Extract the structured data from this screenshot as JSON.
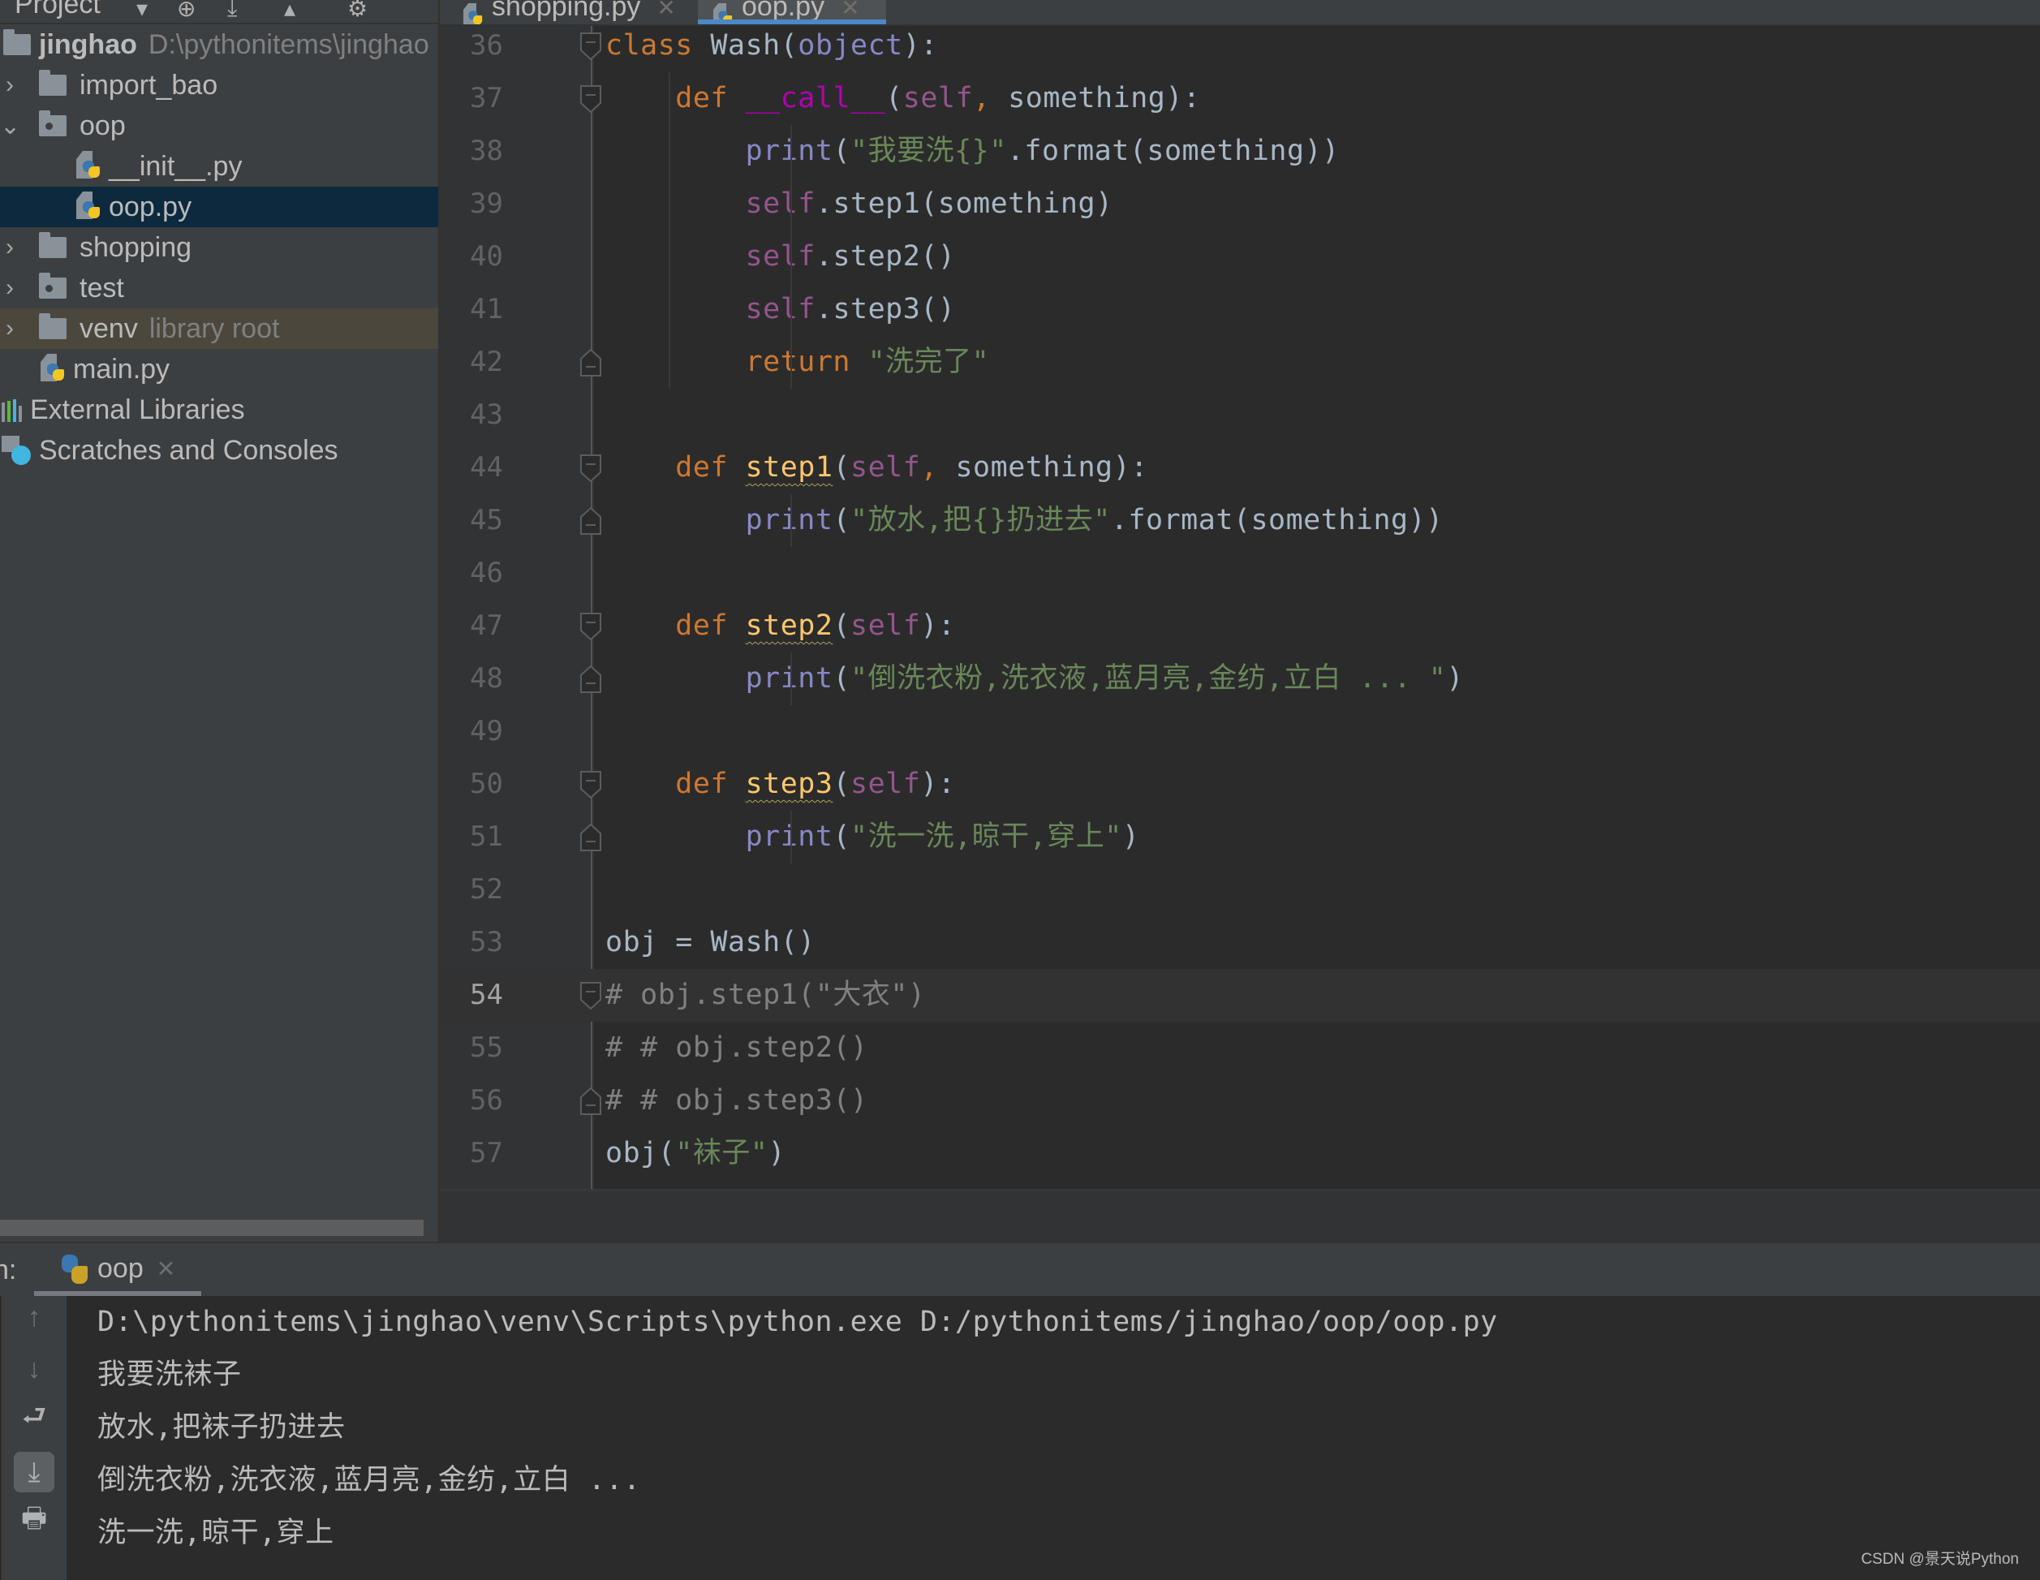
{
  "project_panel": {
    "title": "Project",
    "root": {
      "name": "jinghao",
      "path": "D:\\pythonitems\\jinghao"
    },
    "items": [
      {
        "label": "import_bao",
        "type": "folder",
        "expanded": false,
        "depth": 1
      },
      {
        "label": "oop",
        "type": "package",
        "expanded": true,
        "depth": 1
      },
      {
        "label": "__init__.py",
        "type": "python-file",
        "depth": 2
      },
      {
        "label": "oop.py",
        "type": "python-file",
        "depth": 2,
        "selected": true
      },
      {
        "label": "shopping",
        "type": "folder",
        "expanded": false,
        "depth": 1
      },
      {
        "label": "test",
        "type": "package",
        "expanded": false,
        "depth": 1
      },
      {
        "label": "venv",
        "type": "folder",
        "expanded": false,
        "depth": 1,
        "hint": "library root"
      },
      {
        "label": "main.py",
        "type": "python-file",
        "depth": 1
      },
      {
        "label": "External Libraries",
        "type": "libraries",
        "depth": 0
      },
      {
        "label": "Scratches and Consoles",
        "type": "scratches",
        "depth": 0
      }
    ]
  },
  "editor_tabs": [
    {
      "label": "shopping.py",
      "active": false
    },
    {
      "label": "oop.py",
      "active": true
    }
  ],
  "editor": {
    "current_line": 54,
    "lines": [
      {
        "n": "36",
        "text": "class Wash(object):"
      },
      {
        "n": "37",
        "text": "    def __call__(self, something):"
      },
      {
        "n": "38",
        "text": "        print(\"我要洗{}\".format(something))"
      },
      {
        "n": "39",
        "text": "        self.step1(something)"
      },
      {
        "n": "40",
        "text": "        self.step2()"
      },
      {
        "n": "41",
        "text": "        self.step3()"
      },
      {
        "n": "42",
        "text": "        return \"洗完了\""
      },
      {
        "n": "43",
        "text": ""
      },
      {
        "n": "44",
        "text": "    def step1(self, something):"
      },
      {
        "n": "45",
        "text": "        print(\"放水,把{}扔进去\".format(something))"
      },
      {
        "n": "46",
        "text": ""
      },
      {
        "n": "47",
        "text": "    def step2(self):"
      },
      {
        "n": "48",
        "text": "        print(\"倒洗衣粉,洗衣液,蓝月亮,金纺,立白 ... \")"
      },
      {
        "n": "49",
        "text": ""
      },
      {
        "n": "50",
        "text": "    def step3(self):"
      },
      {
        "n": "51",
        "text": "        print(\"洗一洗,晾干,穿上\")"
      },
      {
        "n": "52",
        "text": ""
      },
      {
        "n": "53",
        "text": "obj = Wash()"
      },
      {
        "n": "54",
        "text": "# obj.step1(\"大衣\")"
      },
      {
        "n": "55",
        "text": "# # obj.step2()"
      },
      {
        "n": "56",
        "text": "# # obj.step3()"
      },
      {
        "n": "57",
        "text": "obj(\"袜子\")"
      }
    ]
  },
  "run_panel": {
    "prefix": "n:",
    "tab_label": "oop",
    "output": [
      "D:\\pythonitems\\jinghao\\venv\\Scripts\\python.exe D:/pythonitems/jinghao/oop/oop.py",
      "我要洗袜子",
      "放水,把袜子扔进去",
      "倒洗衣粉,洗衣液,蓝月亮,金纺,立白 ...",
      "洗一洗,晾干,穿上"
    ],
    "toolbar": [
      "up-arrow-icon",
      "down-arrow-icon",
      "soft-wrap-icon",
      "scroll-to-end-icon",
      "print-icon"
    ]
  },
  "watermark": "CSDN @景天说Python",
  "colors": {
    "keyword": "#cc7832",
    "builtin": "#8888c6",
    "self": "#94558d",
    "string": "#6a8759",
    "magic": "#b200b2",
    "function": "#ffc66d",
    "comment": "#808080",
    "accent": "#4a88c7"
  }
}
